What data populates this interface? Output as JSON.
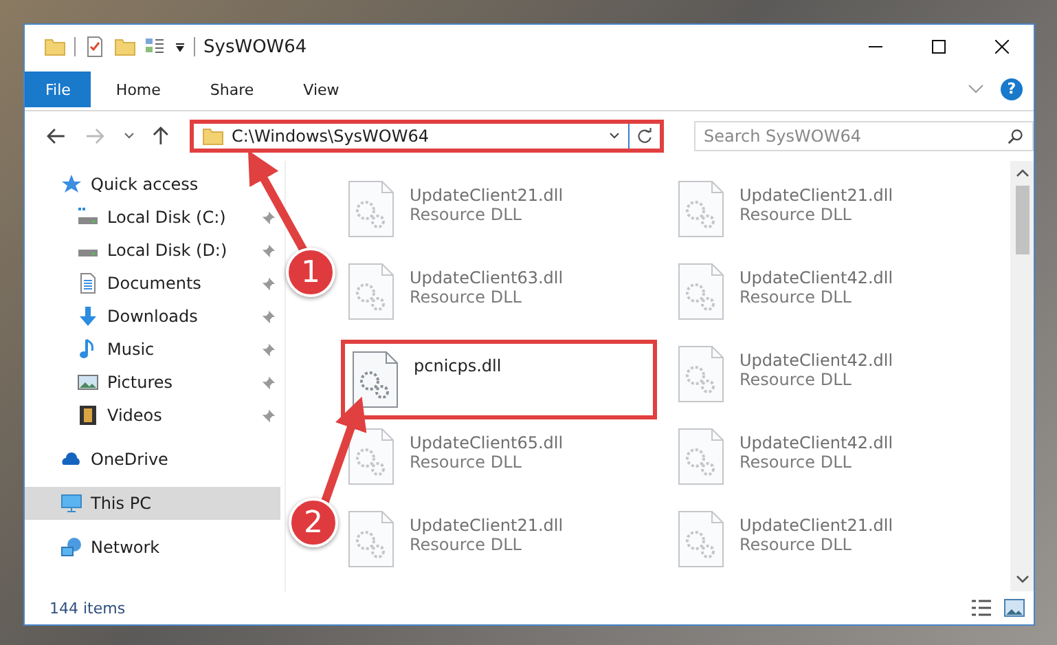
{
  "window": {
    "title": "SysWOW64"
  },
  "ribbon_tabs": [
    {
      "label": "File",
      "selected": true
    },
    {
      "label": "Home",
      "selected": false
    },
    {
      "label": "Share",
      "selected": false
    },
    {
      "label": "View",
      "selected": false
    }
  ],
  "help_button": "?",
  "address_bar": {
    "path": "C:\\Windows\\SysWOW64",
    "highlighted": true
  },
  "search": {
    "placeholder": "Search SysWOW64"
  },
  "sidebar": {
    "items": [
      {
        "label": "Quick access",
        "kind": "star",
        "selected": false,
        "children": [
          {
            "label": "Local Disk (C:)",
            "kind": "drive-c",
            "pinned": true,
            "selected": false
          },
          {
            "label": "Local Disk (D:)",
            "kind": "drive",
            "pinned": true,
            "selected": false
          },
          {
            "label": "Documents",
            "kind": "documents",
            "pinned": true,
            "selected": false
          },
          {
            "label": "Downloads",
            "kind": "downloads",
            "pinned": true,
            "selected": false
          },
          {
            "label": "Music",
            "kind": "music",
            "pinned": true,
            "selected": false
          },
          {
            "label": "Pictures",
            "kind": "pictures",
            "pinned": true,
            "selected": false
          },
          {
            "label": "Videos",
            "kind": "videos",
            "pinned": true,
            "selected": false
          }
        ]
      },
      {
        "label": "OneDrive",
        "kind": "cloud",
        "selected": false
      },
      {
        "label": "This PC",
        "kind": "pc",
        "selected": true
      },
      {
        "label": "Network",
        "kind": "network",
        "selected": false
      }
    ]
  },
  "files": [
    {
      "name": "UpdateClient21.dll",
      "type": "Resource DLL",
      "blurred": true,
      "highlighted": false
    },
    {
      "name": "UpdateClient21.dll",
      "type": "Resource DLL",
      "blurred": true,
      "highlighted": false
    },
    {
      "name": "UpdateClient63.dll",
      "type": "Resource DLL",
      "blurred": true,
      "highlighted": false
    },
    {
      "name": "UpdateClient42.dll",
      "type": "Resource DLL",
      "blurred": true,
      "highlighted": false
    },
    {
      "name": "pcnicps.dll",
      "blurred": false,
      "highlighted": true
    },
    {
      "name": "UpdateClient42.dll",
      "type": "Resource DLL",
      "blurred": true,
      "highlighted": false
    },
    {
      "name": "UpdateClient65.dll",
      "type": "Resource DLL",
      "blurred": true,
      "highlighted": false
    },
    {
      "name": "UpdateClient42.dll",
      "type": "Resource DLL",
      "blurred": true,
      "highlighted": false
    },
    {
      "name": "UpdateClient21.dll",
      "type": "Resource DLL",
      "blurred": true,
      "highlighted": false
    },
    {
      "name": "UpdateClient21.dll",
      "type": "Resource DLL",
      "blurred": true,
      "highlighted": false
    }
  ],
  "status_bar": {
    "item_count": "144 items"
  },
  "callouts": [
    {
      "number": "1"
    },
    {
      "number": "2"
    }
  ]
}
